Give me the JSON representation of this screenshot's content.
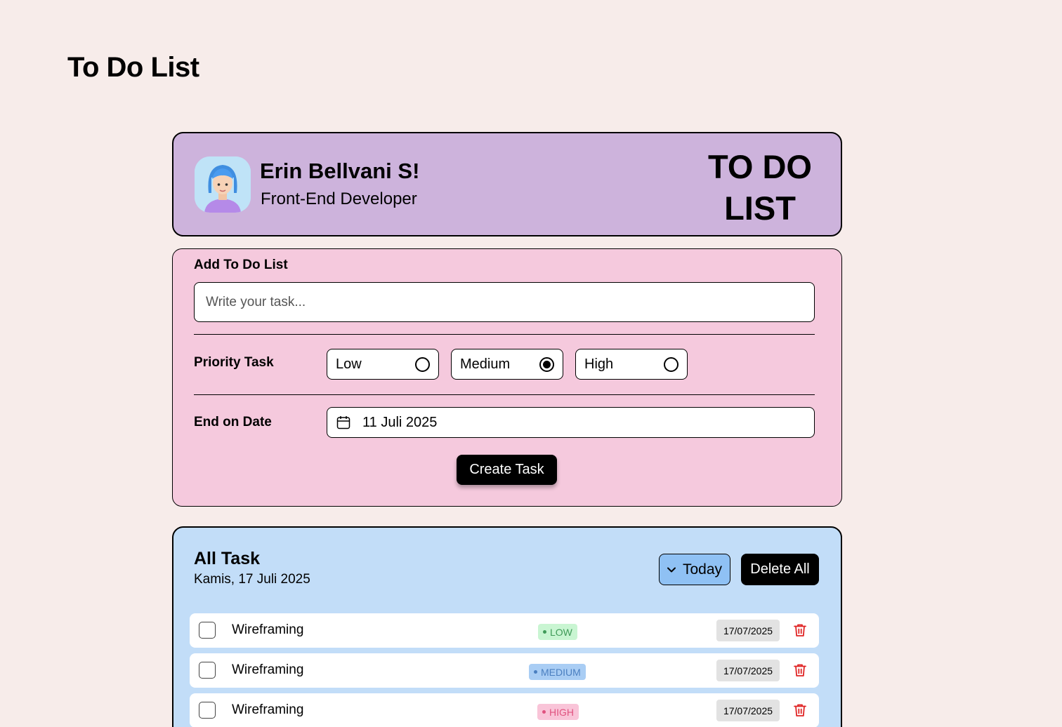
{
  "page": {
    "title": "To Do List"
  },
  "profile": {
    "name": "Erin Bellvani S!",
    "role": "Front-End Developer",
    "brand_line1": "TO DO",
    "brand_line2": "LIST"
  },
  "form": {
    "heading": "Add To Do List",
    "task_placeholder": "Write your task...",
    "priority_label": "Priority Task",
    "priority_options": [
      {
        "label": "Low",
        "selected": false
      },
      {
        "label": "Medium",
        "selected": true
      },
      {
        "label": "High",
        "selected": false
      }
    ],
    "date_label": "End on Date",
    "date_value": "11 Juli 2025",
    "create_button": "Create Task"
  },
  "tasks": {
    "heading": "All Task",
    "date": "Kamis, 17 Juli 2025",
    "filter_label": "Today",
    "delete_all_label": "Delete All",
    "items": [
      {
        "title": "Wireframing",
        "priority": "LOW",
        "date": "17/07/2025"
      },
      {
        "title": "Wireframing",
        "priority": "MEDIUM",
        "date": "17/07/2025"
      },
      {
        "title": "Wireframing",
        "priority": "HIGH",
        "date": "17/07/2025"
      }
    ]
  },
  "colors": {
    "background": "#f7ecea",
    "profile_card": "#cdb3dc",
    "form_card": "#f5c9dd",
    "task_card": "#c2ddf8",
    "filter_button": "#8fc1f4",
    "low_badge_bg": "#c9f5d2",
    "low_badge_text": "#3f9a58",
    "medium_badge_bg": "#a9cdf4",
    "medium_badge_text": "#4a7fc0",
    "high_badge_bg": "#f9c4d8",
    "high_badge_text": "#e0527f",
    "trash_icon": "#e02424"
  }
}
